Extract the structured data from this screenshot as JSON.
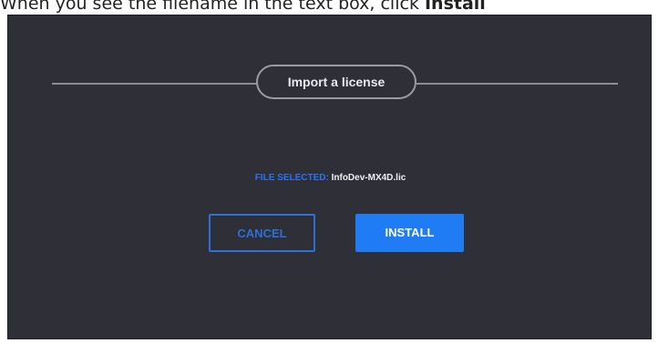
{
  "caption": {
    "text": "When you see the filename in the text box, click ",
    "bold_text": "Install"
  },
  "dialog": {
    "title": "Import a license",
    "file_label": "FILE SELECTED:",
    "file_name": "InfoDev-MX4D.lic",
    "cancel_label": "CANCEL",
    "install_label": "INSTALL"
  },
  "colors": {
    "dialog_bg": "#2e2f37",
    "accent_blue": "#1f7cf5",
    "file_label_blue": "#2d72ef"
  }
}
